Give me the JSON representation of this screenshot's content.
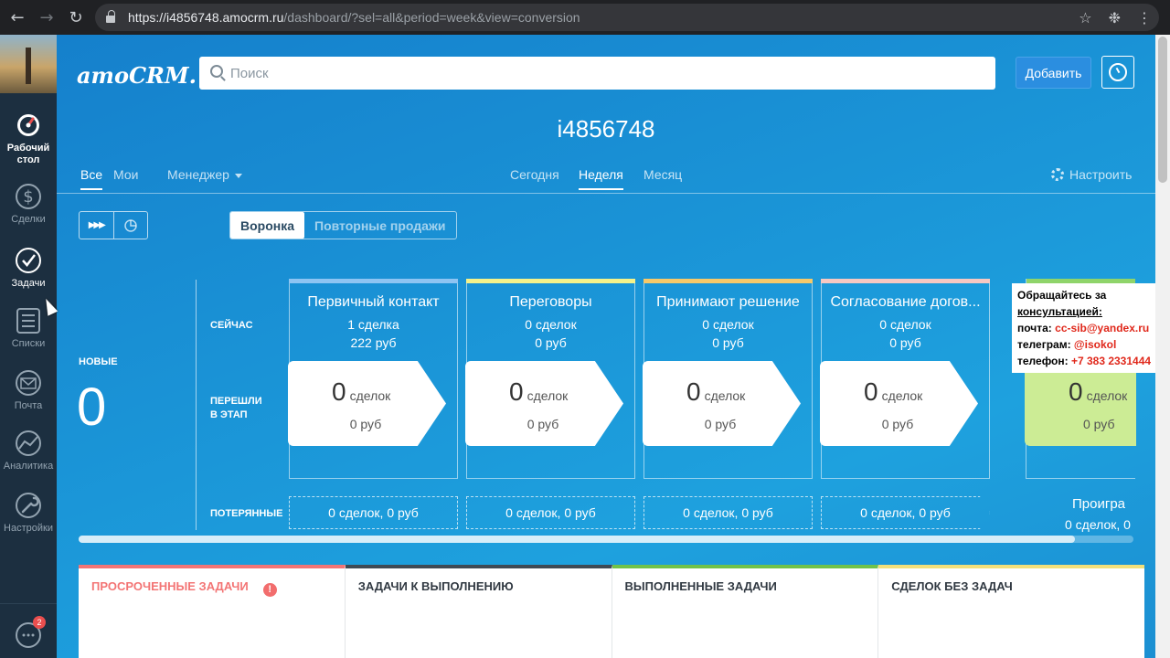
{
  "browser": {
    "url_host": "https://i4856748.amocrm.ru",
    "url_path": "/dashboard/?sel=all&period=week&view=conversion",
    "back_icon": "arrow-left-icon",
    "forward_icon": "arrow-right-icon",
    "reload_icon": "reload-icon"
  },
  "sidebar": {
    "items": [
      {
        "label": "Рабочий стол",
        "icon": "dashboard-gauge-icon",
        "active": true
      },
      {
        "label": "Сделки",
        "icon": "dollar-icon"
      },
      {
        "label": "Задачи",
        "icon": "check-circle-icon"
      },
      {
        "label": "Списки",
        "icon": "list-icon"
      },
      {
        "label": "Почта",
        "icon": "mail-icon"
      },
      {
        "label": "Аналитика",
        "icon": "analytics-icon"
      },
      {
        "label": "Настройки",
        "icon": "wrench-icon"
      }
    ],
    "chat_badge": "2"
  },
  "header": {
    "logo": "amoCRM.",
    "search_placeholder": "Поиск",
    "add_button": "Добавить",
    "account": "i4856748"
  },
  "filters": {
    "all": "Все",
    "mine": "Мои",
    "manager": "Менеджер",
    "today": "Сегодня",
    "week": "Неделя",
    "month": "Месяц",
    "configure": "Настроить"
  },
  "pipeline_tabs": {
    "funnel": "Воронка",
    "repeat": "Повторные продажи"
  },
  "pipeline": {
    "row_now": "СЕЙЧАС",
    "row_moved": "ПЕРЕШЛИ\nВ ЭТАП",
    "row_lost": "ПОТЕРЯННЫЕ",
    "new_label": "НОВЫЕ",
    "new_count": "0",
    "stages": [
      {
        "name": "Первичный контакт",
        "count": "1 сделка",
        "sum": "222 руб",
        "moved": "0",
        "moved_unit": "сделок",
        "moved_sum": "0 руб",
        "lost": "0 сделок, 0 руб",
        "color": "#8ec4f2"
      },
      {
        "name": "Переговоры",
        "count": "0 сделок",
        "sum": "0 руб",
        "moved": "0",
        "moved_unit": "сделок",
        "moved_sum": "0 руб",
        "lost": "0 сделок, 0 руб",
        "color": "#f4f28a"
      },
      {
        "name": "Принимают решение",
        "count": "0 сделок",
        "sum": "0 руб",
        "moved": "0",
        "moved_unit": "сделок",
        "moved_sum": "0 руб",
        "lost": "0 сделок, 0 руб",
        "color": "#f6c96a"
      },
      {
        "name": "Согласование догов...",
        "count": "0 сделок",
        "sum": "0 руб",
        "moved": "0",
        "moved_unit": "сделок",
        "moved_sum": "0 руб",
        "lost": "0 сделок, 0 руб",
        "color": "#f6c8c2"
      }
    ],
    "won": {
      "moved": "0",
      "moved_unit": "сделок",
      "moved_sum": "0 руб"
    },
    "lost_title": "Проигра",
    "lost_sub": "0 сделок, 0"
  },
  "consult": {
    "line1": "Обращайтесь за",
    "line2": "консультацией:",
    "email_label": "почта:",
    "email": "cc-sib@yandex.ru",
    "telegram_label": "телеграм:",
    "telegram": "@isokol",
    "phone_label": "телефон:",
    "phone": "+7 383 2331444"
  },
  "panels": [
    {
      "title": "ПРОСРОЧЕННЫЕ ЗАДАЧИ",
      "color": "#f37575",
      "text_color": "#f37575"
    },
    {
      "title": "ЗАДАЧИ К ВЫПОЛНЕНИЮ",
      "color": "#3f4a54",
      "text_color": "#313942"
    },
    {
      "title": "ВЫПОЛНЕННЫЕ ЗАДАЧИ",
      "color": "#70c24a",
      "text_color": "#313942"
    },
    {
      "title": "СДЕЛОК БЕЗ ЗАДАЧ",
      "color": "#f3e07a",
      "text_color": "#313942"
    }
  ]
}
